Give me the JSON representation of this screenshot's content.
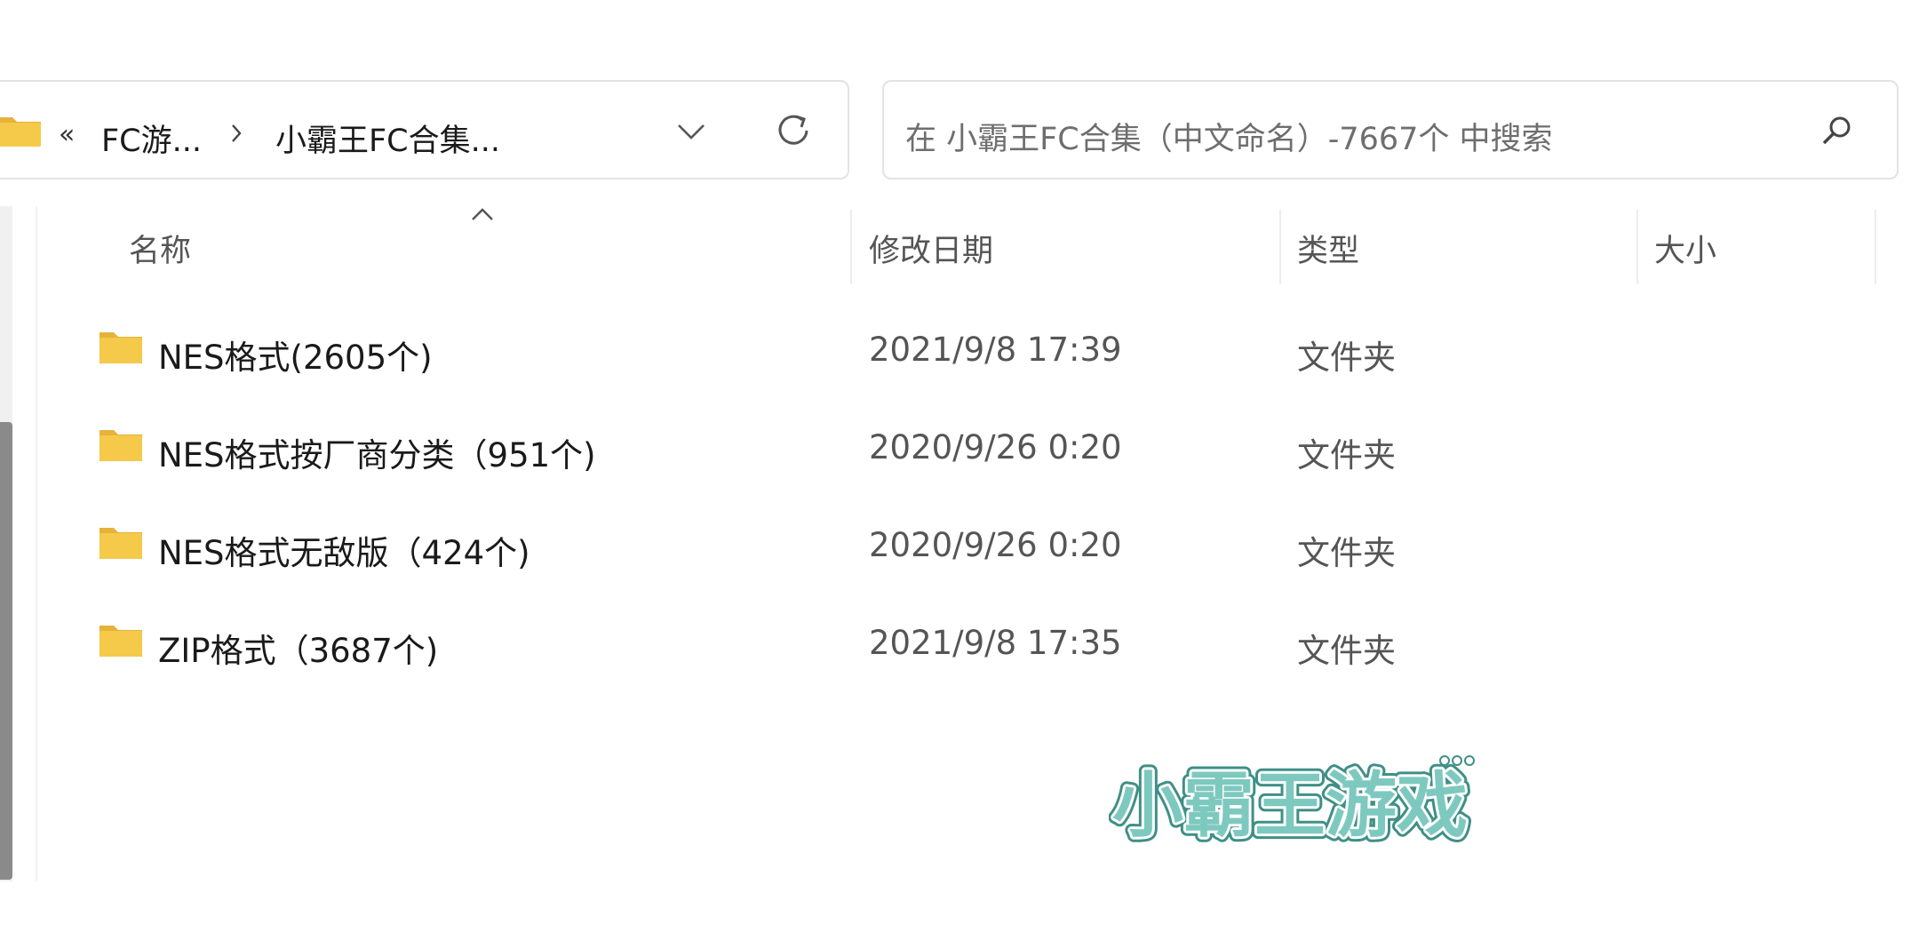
{
  "breadcrumb": {
    "overflow": "«",
    "items": [
      "FC游...",
      "小霸王FC合集..."
    ]
  },
  "search": {
    "placeholder": "在 小霸王FC合集（中文命名）-7667个 中搜索"
  },
  "columns": {
    "name": "名称",
    "date": "修改日期",
    "type": "类型",
    "size": "大小"
  },
  "files": [
    {
      "name": "NES格式(2605个)",
      "date": "2021/9/8 17:39",
      "type": "文件夹",
      "icon": "folder-icon"
    },
    {
      "name": "NES格式按厂商分类（951个)",
      "date": "2020/9/26 0:20",
      "type": "文件夹",
      "icon": "folder-icon"
    },
    {
      "name": "NES格式无敌版（424个)",
      "date": "2020/9/26 0:20",
      "type": "文件夹",
      "icon": "folder-icon"
    },
    {
      "name": "ZIP格式（3687个)",
      "date": "2021/9/8 17:35",
      "type": "文件夹",
      "icon": "folder-icon"
    }
  ],
  "watermark": {
    "text": "小霸王游戏"
  },
  "colors": {
    "folder": "#f5c94a",
    "folder_dark": "#e6b23a",
    "watermark_fill": "#7ec9bf",
    "border": "#e3e3e3"
  }
}
